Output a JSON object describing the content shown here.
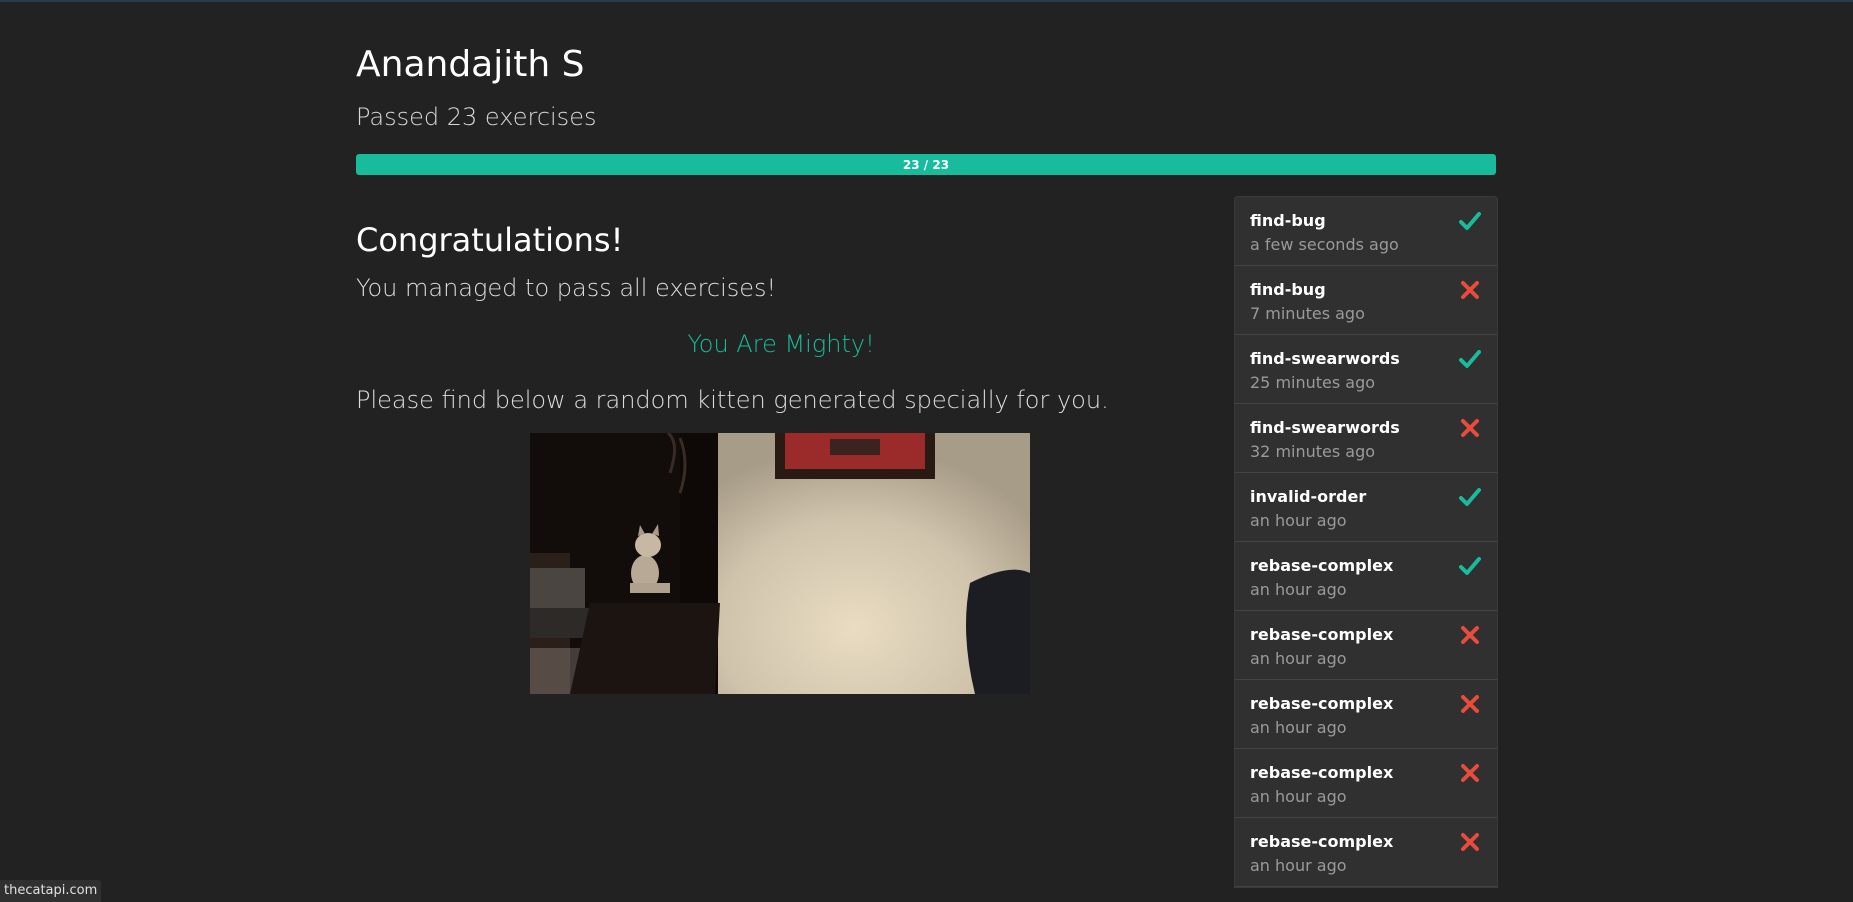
{
  "user": {
    "name": "Anandajith S",
    "passed_text": "Passed 23 exercises"
  },
  "progress": {
    "label": "23 / 23",
    "fraction": 1.0,
    "color": "#18bc9c"
  },
  "main": {
    "congrats_title": "Congratulations!",
    "managed_text": "You managed to pass all exercises!",
    "mighty_text": "You Are Mighty!",
    "kitten_text": "Please find below a random kitten generated specially for you."
  },
  "runs": [
    {
      "name": "find-bug",
      "time": "a few seconds ago",
      "status": "pass"
    },
    {
      "name": "find-bug",
      "time": "7 minutes ago",
      "status": "fail"
    },
    {
      "name": "find-swearwords",
      "time": "25 minutes ago",
      "status": "pass"
    },
    {
      "name": "find-swearwords",
      "time": "32 minutes ago",
      "status": "fail"
    },
    {
      "name": "invalid-order",
      "time": "an hour ago",
      "status": "pass"
    },
    {
      "name": "rebase-complex",
      "time": "an hour ago",
      "status": "pass"
    },
    {
      "name": "rebase-complex",
      "time": "an hour ago",
      "status": "fail"
    },
    {
      "name": "rebase-complex",
      "time": "an hour ago",
      "status": "fail"
    },
    {
      "name": "rebase-complex",
      "time": "an hour ago",
      "status": "fail"
    },
    {
      "name": "rebase-complex",
      "time": "an hour ago",
      "status": "fail"
    }
  ],
  "status_colors": {
    "pass": "#18bc9c",
    "fail": "#e74c3c"
  },
  "icons": {
    "pass": "check-icon",
    "fail": "cross-icon"
  },
  "status_bar": {
    "url": "thecatapi.com"
  }
}
